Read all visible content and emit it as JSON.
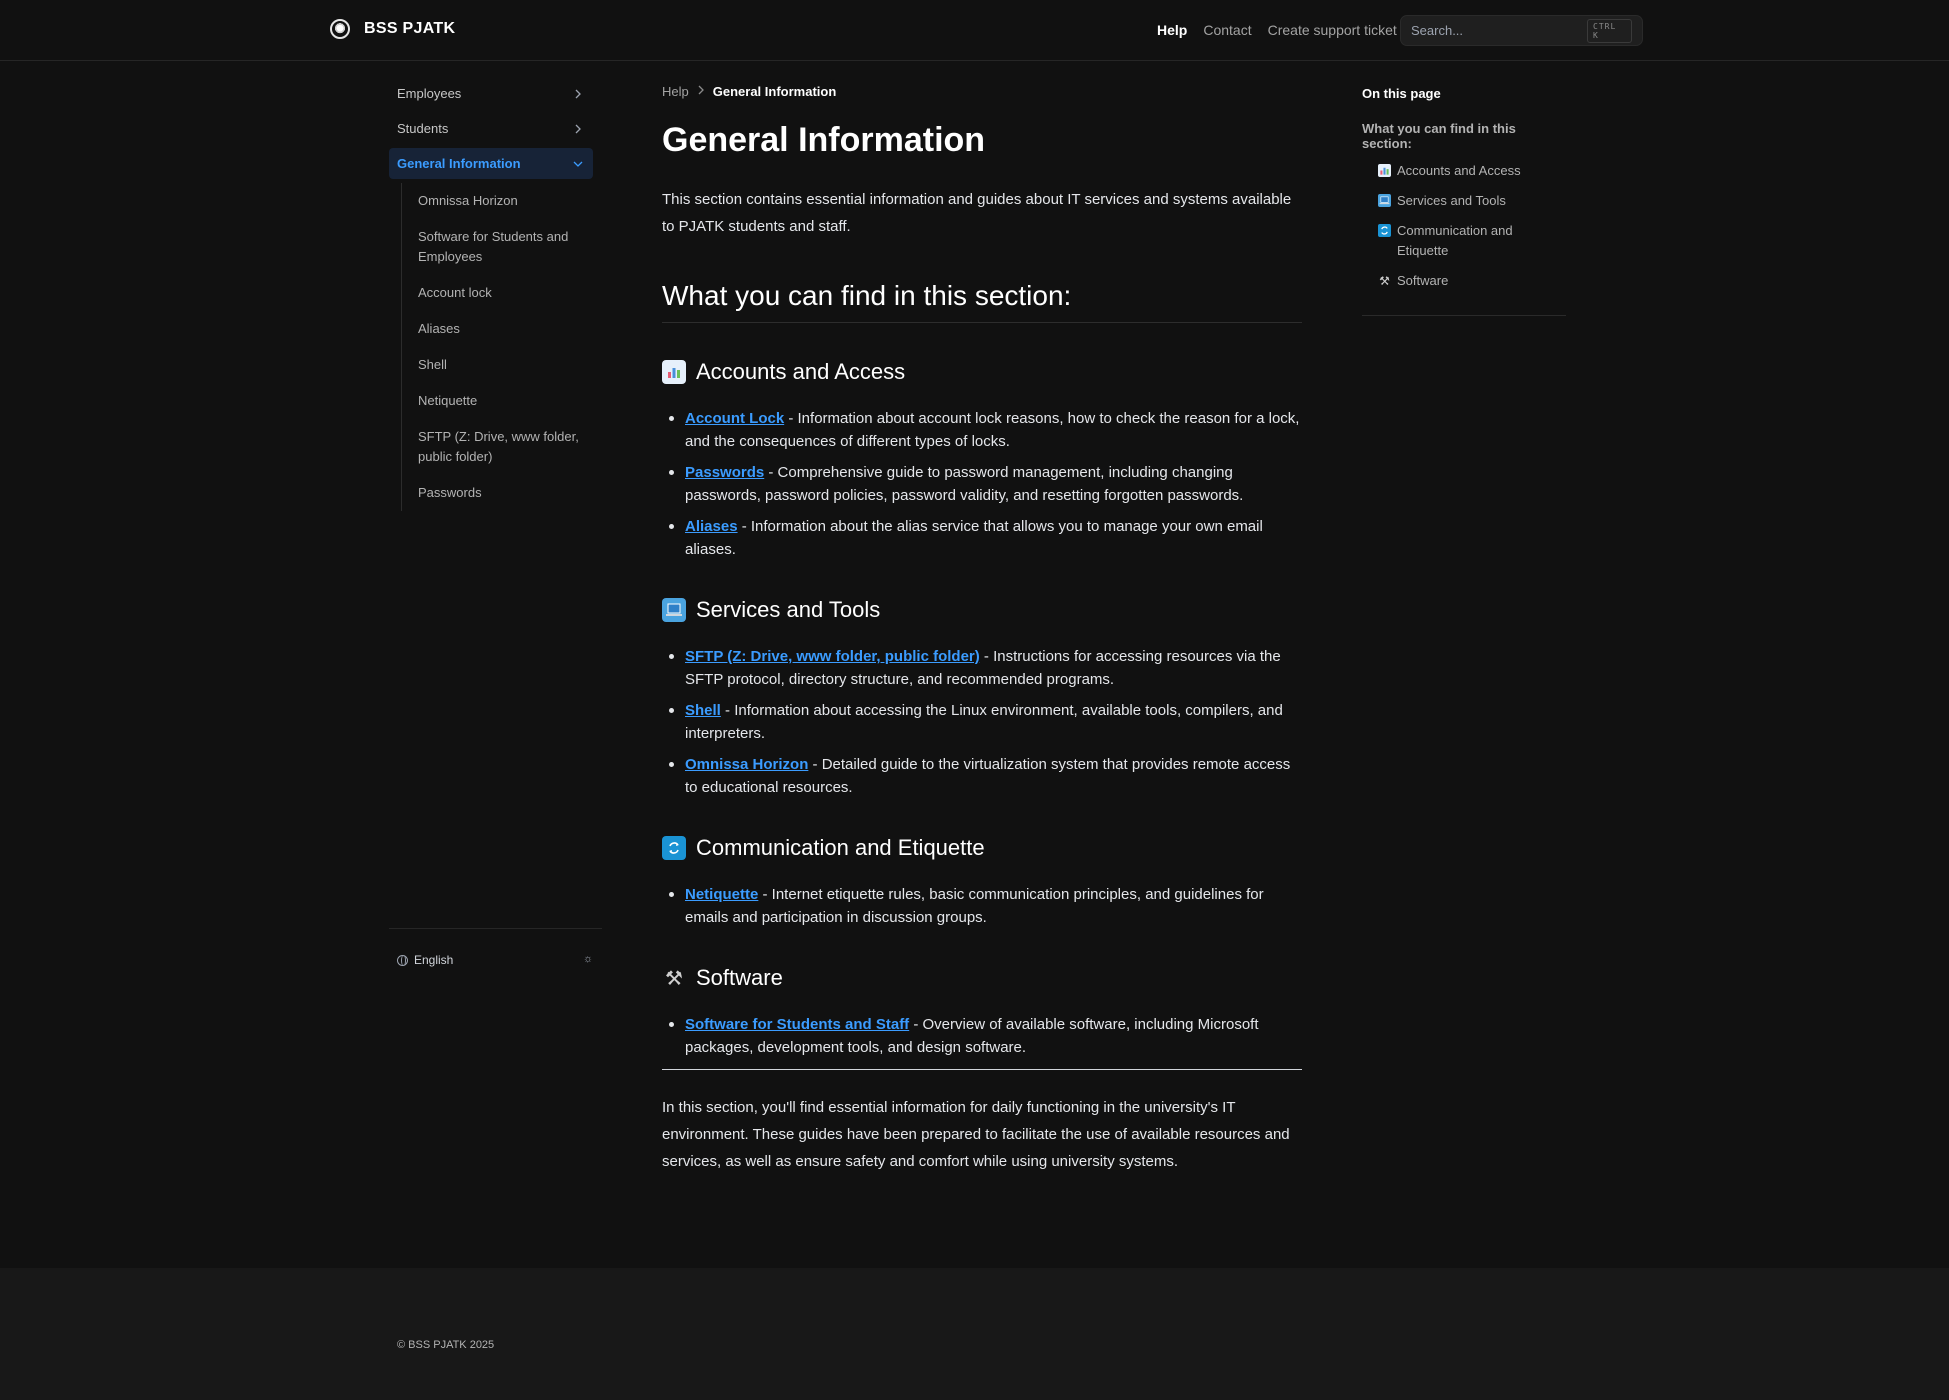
{
  "header": {
    "logo_text": "BSS PJATK",
    "nav": [
      {
        "label": "Help",
        "active": true
      },
      {
        "label": "Contact",
        "active": false
      },
      {
        "label": "Create support ticket",
        "active": false
      }
    ],
    "search": {
      "placeholder": "Search...",
      "shortcut": "CTRL K"
    }
  },
  "sidebar": {
    "items": [
      {
        "label": "Employees"
      },
      {
        "label": "Students"
      },
      {
        "label": "General Information"
      }
    ],
    "subitems": [
      {
        "label": "Omnissa Horizon"
      },
      {
        "label": "Software for Students and Employees"
      },
      {
        "label": "Account lock"
      },
      {
        "label": "Aliases"
      },
      {
        "label": "Shell"
      },
      {
        "label": "Netiquette"
      },
      {
        "label": "SFTP (Z: Drive, www folder, public folder)"
      },
      {
        "label": "Passwords"
      }
    ],
    "language": "English"
  },
  "breadcrumb": {
    "parent": "Help",
    "current": "General Information"
  },
  "main": {
    "title": "General Information",
    "intro": "This section contains essential information and guides about IT services and systems available to PJATK students and staff.",
    "section_heading": "What you can find in this section:",
    "sections": [
      {
        "title": "Accounts and Access",
        "icon": "bar-chart-emoji-icon",
        "items": [
          {
            "link": "Account Lock",
            "text": " - Information about account lock reasons, how to check the reason for a lock, and the consequences of different types of locks."
          },
          {
            "link": "Passwords",
            "text": " - Comprehensive guide to password management, including changing passwords, password policies, password validity, and resetting forgotten passwords."
          },
          {
            "link": "Aliases",
            "text": " - Information about the alias service that allows you to manage your own email aliases."
          }
        ]
      },
      {
        "title": "Services and Tools",
        "icon": "laptop-emoji-icon",
        "items": [
          {
            "link": "SFTP (Z: Drive, www folder, public folder)",
            "text": " - Instructions for accessing resources via the SFTP protocol, directory structure, and recommended programs."
          },
          {
            "link": "Shell",
            "text": " - Information about accessing the Linux environment, available tools, compilers, and interpreters."
          },
          {
            "link": "Omnissa Horizon",
            "text": " - Detailed guide to the virtualization system that provides remote access to educational resources."
          }
        ]
      },
      {
        "title": "Communication and Etiquette",
        "icon": "arrows-emoji-icon",
        "items": [
          {
            "link": "Netiquette",
            "text": " - Internet etiquette rules, basic communication principles, and guidelines for emails and participation in discussion groups."
          }
        ]
      },
      {
        "title": "Software",
        "icon": "tools-emoji-icon",
        "items": [
          {
            "link": "Software for Students and Staff",
            "text": " - Overview of available software, including Microsoft packages, development tools, and design software."
          }
        ]
      }
    ],
    "outro": "In this section, you'll find essential information for daily functioning in the university's IT environment. These guides have been prepared to facilitate the use of available resources and services, as well as ensure safety and comfort while using university systems."
  },
  "toc": {
    "title": "On this page",
    "heading": "What you can find in this section:",
    "items": [
      {
        "label": "Accounts and Access"
      },
      {
        "label": "Services and Tools"
      },
      {
        "label": "Communication and Etiquette"
      },
      {
        "label": "Software"
      }
    ]
  },
  "footer": {
    "copyright": "© BSS PJATK 2025"
  }
}
